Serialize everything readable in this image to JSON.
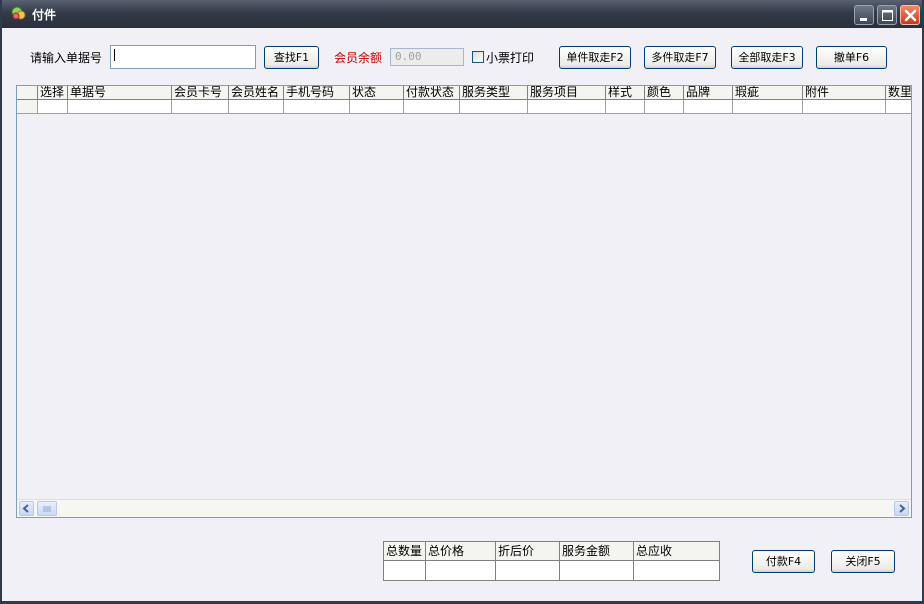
{
  "window": {
    "title": "付件",
    "colors": {
      "titlebar": "#333a47",
      "client": "#f0f0f6",
      "accent_label": "#cc0000"
    }
  },
  "toolbar": {
    "order_label": "请输入单据号",
    "order_value": "",
    "find_button": "查找F1",
    "balance_label": "会员余额",
    "balance_value": "0.00",
    "print_checkbox_label": "小票打印",
    "print_checked": false,
    "single_pickup_button": "单件取走F2",
    "multi_pickup_button": "多件取走F7",
    "all_pickup_button": "全部取走F3",
    "cancel_order_button": "撤单F6"
  },
  "grid": {
    "columns": [
      "选择",
      "单据号",
      "会员卡号",
      "会员姓名",
      "手机号码",
      "状态",
      "付款状态",
      "服务类型",
      "服务项目",
      "样式",
      "颜色",
      "品牌",
      "瑕疵",
      "附件",
      "数里"
    ],
    "rows": []
  },
  "summary": {
    "columns": [
      "总数量",
      "总价格",
      "折后价",
      "服务金额",
      "总应收"
    ],
    "values": [
      "",
      "",
      "",
      "",
      ""
    ]
  },
  "footer": {
    "pay_button": "付款F4",
    "close_button": "关闭F5"
  }
}
